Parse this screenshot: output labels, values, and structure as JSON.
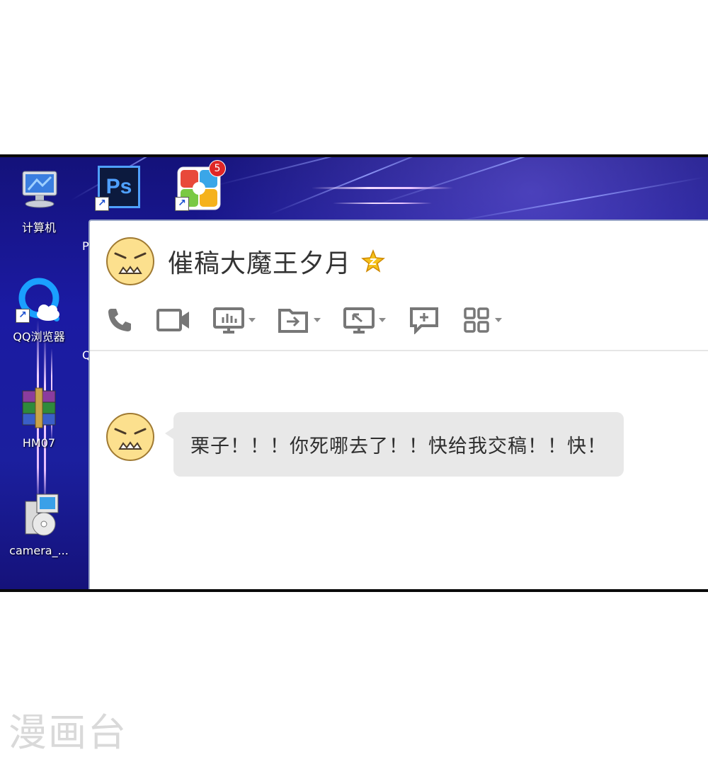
{
  "desktop": {
    "icons": [
      {
        "label": "计算机",
        "icon": "computer-icon"
      },
      {
        "label": "",
        "icon": "photoshop-icon",
        "glyph_text": "Ps"
      },
      {
        "label": "",
        "icon": "app-store-icon",
        "badge": "5"
      },
      {
        "label": "QQ浏览器",
        "icon": "qq-browser-icon"
      },
      {
        "label": "HM07",
        "icon": "winrar-icon"
      },
      {
        "label": "camera_...",
        "icon": "installer-icon"
      }
    ],
    "clipped_letters": [
      "P",
      "Q"
    ]
  },
  "chat": {
    "title": "催稿大魔王夕月",
    "title_badge": "star-badge-icon",
    "toolbar": [
      "phone-icon",
      "video-icon",
      "share-screen-icon",
      "file-transfer-icon",
      "remote-desktop-icon",
      "add-chat-icon",
      "more-apps-icon"
    ],
    "messages": [
      {
        "sender_avatar": "angry-face-avatar",
        "text": "栗子！！！你死哪去了！！快给我交稿！！快！"
      }
    ]
  },
  "watermark": "漫画台",
  "colors": {
    "desktop_bg": "#1b1aa2",
    "bubble_bg": "#e8e8e8",
    "avatar_face": "#fce08e"
  }
}
